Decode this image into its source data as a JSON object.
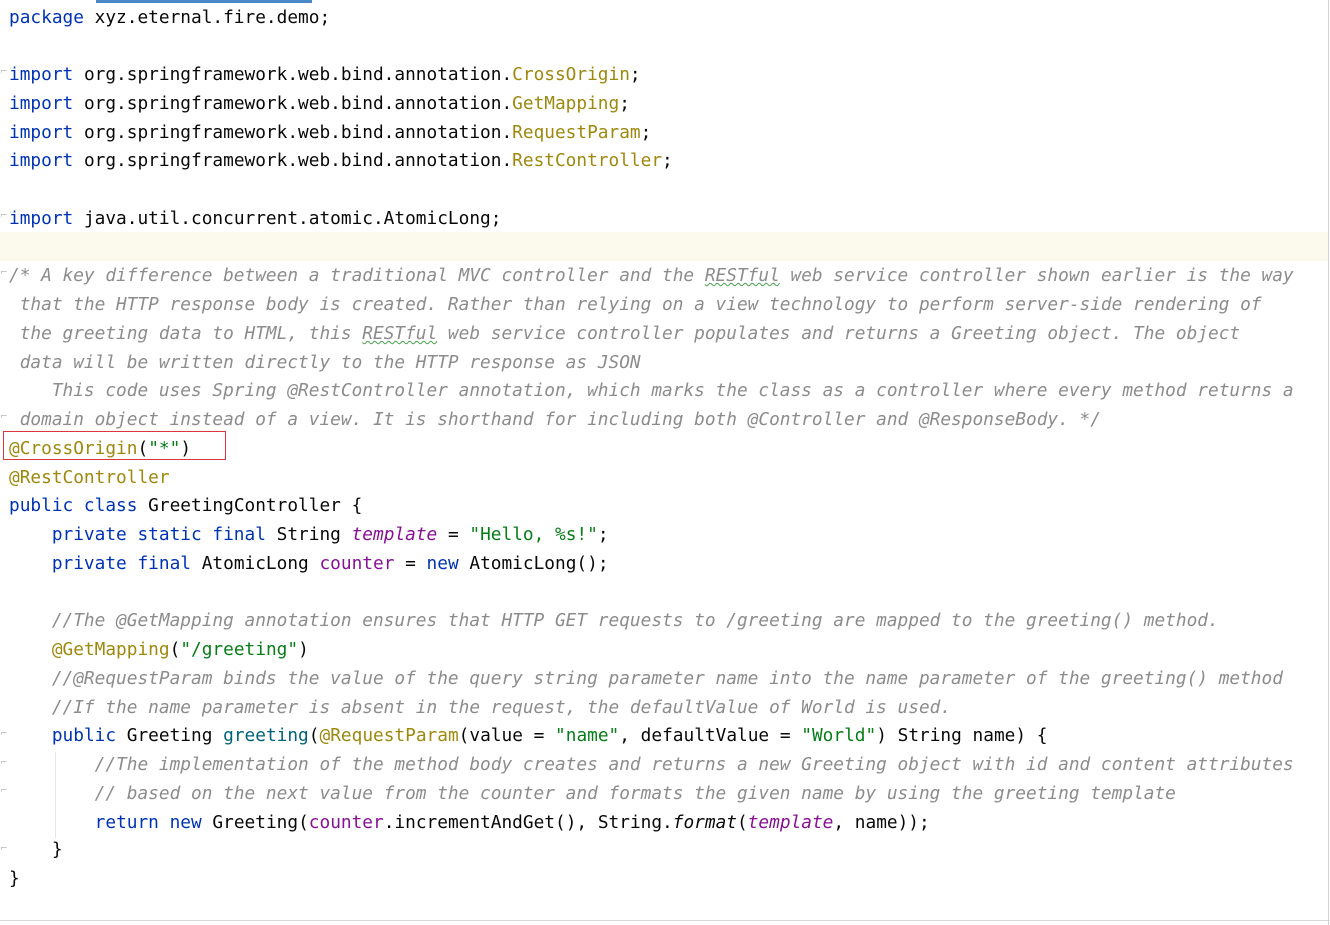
{
  "code": {
    "package_kw": "package",
    "package_name": " xyz.eternal.fire.demo;",
    "imports": [
      {
        "kw": "import",
        "path": " org.springframework.web.bind.annotation.",
        "cls": "CrossOrigin",
        "end": ";"
      },
      {
        "kw": "import",
        "path": " org.springframework.web.bind.annotation.",
        "cls": "GetMapping",
        "end": ";"
      },
      {
        "kw": "import",
        "path": " org.springframework.web.bind.annotation.",
        "cls": "RequestParam",
        "end": ";"
      },
      {
        "kw": "import",
        "path": " org.springframework.web.bind.annotation.",
        "cls": "RestController",
        "end": ";"
      }
    ],
    "import_atomic_kw": "import",
    "import_atomic_path": " java.util.concurrent.atomic.AtomicLong;",
    "block_comment": {
      "l1a": "/* A key difference between a traditional MVC controller and the ",
      "l1b": "RESTful",
      "l1c": " web service controller shown earlier is the way",
      "l2": " that the HTTP response body is created. Rather than relying on a view technology to perform server-side rendering of",
      "l3a": " the greeting data to HTML, this ",
      "l3b": "RESTful",
      "l3c": " web service controller populates and returns a Greeting object. The object",
      "l4": " data will be written directly to the HTTP response as JSON",
      "l5": "    This code uses Spring @RestController annotation, which marks the class as a controller where every method returns a",
      "l6": " domain object instead of a view. It is shorthand for including both @Controller and @ResponseBody. */"
    },
    "cross_origin_ann": "@CrossOrigin",
    "cross_origin_open": "(",
    "cross_origin_arg": "\"*\"",
    "cross_origin_close": ")",
    "rest_controller_ann": "@RestController",
    "class_kw": "public class",
    "class_name": " GreetingController {",
    "template_decl_kw": "    private static final",
    "template_type": " String ",
    "template_field": "template",
    "template_eq": " = ",
    "template_value": "\"Hello, %s!\"",
    "template_end": ";",
    "counter_decl_kw": "    private final",
    "counter_type": " AtomicLong ",
    "counter_field": "counter",
    "counter_eq": " = ",
    "counter_new": "new",
    "counter_ctor": " AtomicLong();",
    "comment_getmapping": "    //The @GetMapping annotation ensures that HTTP GET requests to /greeting are mapped to the greeting() method.",
    "getmapping_indent": "    ",
    "getmapping_ann": "@GetMapping",
    "getmapping_open": "(",
    "getmapping_arg": "\"/greeting\"",
    "getmapping_close": ")",
    "comment_requestparam": "    //@RequestParam binds the value of the query string parameter name into the name parameter of the greeting() method",
    "comment_absent": "    //If the name parameter is absent in the request, the defaultValue of World is used.",
    "method_indent": "    ",
    "method_kw": "public",
    "method_type": " Greeting ",
    "method_name": "greeting",
    "method_open": "(",
    "method_ann": "@RequestParam",
    "method_args1": "(value = ",
    "method_val1": "\"name\"",
    "method_args2": ", defaultValue = ",
    "method_val2": "\"World\"",
    "method_args3": ") String name) {",
    "comment_impl1": "        //The implementation of the method body creates and returns a new Greeting object with id and content attributes",
    "comment_impl2": "        // based on the next value from the counter and formats the given name by using the greeting template",
    "return_indent": "        ",
    "return_kw": "return new",
    "return_ctor": " Greeting(",
    "return_counter": "counter",
    "return_mid": ".incrementAndGet(), String.",
    "return_format": "format",
    "return_open": "(",
    "return_template": "template",
    "return_end": ", name));",
    "method_close": "    }",
    "class_close": "}"
  },
  "colors": {
    "keyword": "#0033b3",
    "annotation": "#9e880d",
    "string": "#067d17",
    "field": "#871094",
    "method": "#00627a",
    "comment": "#8c8c8c",
    "highlight_border": "#d9363e",
    "caret_row": "#fcfaed"
  },
  "icons": [
    "fold-marker-icon"
  ]
}
